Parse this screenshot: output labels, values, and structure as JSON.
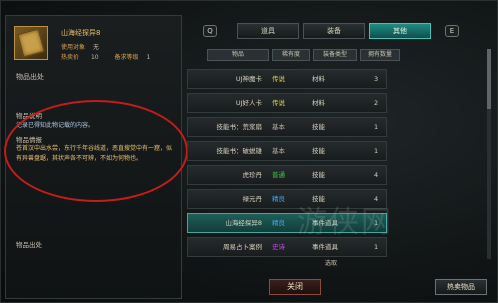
{
  "left_panel": {
    "item_name": "山海经探异8",
    "meta_row1_label": "使用对象",
    "meta_row1_value": "无",
    "meta_row2_label": "热卖价",
    "meta_row2_value": "10",
    "meta_row2_label2": "备求等级",
    "meta_row2_value2": "1",
    "source_header": "物品出处",
    "desc_header": "物品说明",
    "desc_text": "记录已得知此物记载的内容。",
    "info_header": "物品情报",
    "info_text": "苍首汉中出水尝，东行千年谷线道，恶直搜觉中有一窟，似有异兽盘踞，其状声各不可辨，不如为何物也。",
    "drop_header": "物品出处"
  },
  "toolbar": {
    "key_left": "Q",
    "key_right": "E",
    "tabs": [
      {
        "label": "道具",
        "active": false
      },
      {
        "label": "装备",
        "active": false
      },
      {
        "label": "其他",
        "active": true
      }
    ]
  },
  "columns": [
    "物品",
    "稀有度",
    "装备类型",
    "拥有数量"
  ],
  "rows": [
    {
      "name": "UJ神魔卡",
      "rarity": "传说",
      "rarity_color": "#e6d24a",
      "type": "材料",
      "count": "3"
    },
    {
      "name": "UJ好人卡",
      "rarity": "传说",
      "rarity_color": "#e6d24a",
      "type": "材料",
      "count": "2"
    },
    {
      "name": "技能书：荒浆扇",
      "rarity": "基本",
      "rarity_color": "#b9b3a2",
      "type": "技能",
      "count": "1"
    },
    {
      "name": "技能书：破蜕雄",
      "rarity": "基本",
      "rarity_color": "#b9b3a2",
      "type": "技能",
      "count": "1"
    },
    {
      "name": "虎珍丹",
      "rarity": "普通",
      "rarity_color": "#46c94a",
      "type": "技能",
      "count": "4"
    },
    {
      "name": "禄元丹",
      "rarity": "精良",
      "rarity_color": "#4aa3e6",
      "type": "技能",
      "count": "4"
    },
    {
      "name": "山海经探异8",
      "rarity": "精良",
      "rarity_color": "#4aa3e6",
      "type": "事件道具",
      "count": "1",
      "selected": true
    },
    {
      "name": "周易占卜案例",
      "rarity": "史诗",
      "rarity_color": "#c24ae6",
      "type": "事件道具",
      "count": "1"
    }
  ],
  "take_label": "选取",
  "buttons": {
    "close": "关闭",
    "quick": "热卖物品"
  },
  "watermark": "游侠网"
}
